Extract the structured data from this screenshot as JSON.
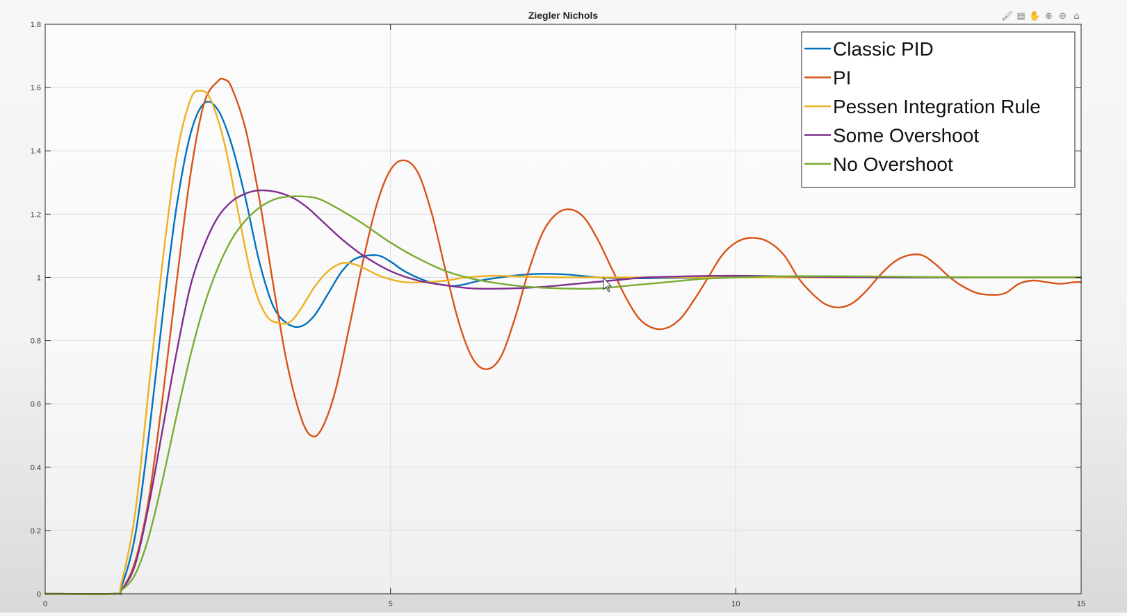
{
  "toolbar": {
    "icons": [
      "brush-icon",
      "datatip-icon",
      "pan-icon",
      "zoom-in-icon",
      "zoom-out-icon",
      "home-icon"
    ]
  },
  "chart_data": {
    "type": "line",
    "title": "Ziegler Nichols",
    "xlabel": "",
    "ylabel": "",
    "xlim": [
      0,
      15
    ],
    "ylim": [
      0,
      1.8
    ],
    "xticks": [
      "0",
      "5",
      "10",
      "15"
    ],
    "yticks": [
      "0",
      "0.2",
      "0.4",
      "0.6",
      "0.8",
      "1",
      "1.2",
      "1.4",
      "1.6",
      "1.8"
    ],
    "grid": true,
    "legend_position": "top-right",
    "series": [
      {
        "name": "Classic PID",
        "color": "#0072BD",
        "x": [
          0,
          1.0,
          1.1,
          1.3,
          1.5,
          1.7,
          1.9,
          2.1,
          2.3,
          2.5,
          2.7,
          2.9,
          3.1,
          3.3,
          3.5,
          3.7,
          3.9,
          4.1,
          4.3,
          4.5,
          4.8,
          5.0,
          5.2,
          5.5,
          5.8,
          6.0,
          6.3,
          6.6,
          7.0,
          7.5,
          8.0,
          8.5,
          9.0,
          10.0,
          11.0,
          12.0,
          13.0,
          14.0,
          15.0
        ],
        "y": [
          0,
          0,
          0.02,
          0.18,
          0.5,
          0.88,
          1.22,
          1.45,
          1.55,
          1.53,
          1.42,
          1.25,
          1.05,
          0.91,
          0.855,
          0.845,
          0.88,
          0.95,
          1.02,
          1.06,
          1.07,
          1.05,
          1.02,
          0.99,
          0.975,
          0.975,
          0.99,
          1.0,
          1.01,
          1.01,
          1.0,
          0.997,
          0.998,
          1.0,
          1.002,
          1.0,
          1.0,
          1.0,
          1.0
        ]
      },
      {
        "name": "PI",
        "color": "#D95319",
        "x": [
          0,
          1.0,
          1.1,
          1.3,
          1.5,
          1.7,
          1.9,
          2.1,
          2.3,
          2.5,
          2.6,
          2.7,
          2.9,
          3.1,
          3.3,
          3.5,
          3.7,
          3.85,
          4.0,
          4.2,
          4.4,
          4.6,
          4.8,
          5.0,
          5.2,
          5.4,
          5.6,
          5.8,
          6.0,
          6.2,
          6.4,
          6.6,
          6.8,
          7.0,
          7.2,
          7.4,
          7.6,
          7.8,
          8.0,
          8.2,
          8.4,
          8.6,
          8.8,
          9.0,
          9.2,
          9.4,
          9.6,
          9.8,
          10.0,
          10.2,
          10.45,
          10.7,
          10.9,
          11.1,
          11.3,
          11.5,
          11.7,
          11.9,
          12.1,
          12.3,
          12.5,
          12.7,
          12.9,
          13.1,
          13.3,
          13.5,
          13.7,
          13.9,
          14.1,
          14.3,
          14.5,
          14.7,
          14.9,
          15.0
        ],
        "y": [
          0,
          0,
          0.01,
          0.1,
          0.3,
          0.62,
          0.98,
          1.32,
          1.55,
          1.62,
          1.625,
          1.6,
          1.47,
          1.25,
          0.98,
          0.73,
          0.56,
          0.5,
          0.52,
          0.64,
          0.84,
          1.05,
          1.23,
          1.34,
          1.37,
          1.33,
          1.2,
          1.02,
          0.85,
          0.74,
          0.71,
          0.75,
          0.87,
          1.02,
          1.14,
          1.2,
          1.215,
          1.19,
          1.12,
          1.03,
          0.94,
          0.87,
          0.84,
          0.84,
          0.87,
          0.93,
          1.0,
          1.07,
          1.11,
          1.125,
          1.115,
          1.07,
          1.0,
          0.95,
          0.915,
          0.905,
          0.92,
          0.96,
          1.01,
          1.05,
          1.07,
          1.07,
          1.04,
          1.0,
          0.97,
          0.95,
          0.945,
          0.95,
          0.98,
          0.99,
          0.985,
          0.98,
          0.985,
          0.985
        ]
      },
      {
        "name": "Pessen Integration Rule",
        "color": "#EDB120",
        "x": [
          0,
          1.0,
          1.1,
          1.3,
          1.5,
          1.7,
          1.9,
          2.1,
          2.25,
          2.4,
          2.6,
          2.8,
          3.0,
          3.2,
          3.4,
          3.55,
          3.7,
          3.9,
          4.1,
          4.3,
          4.5,
          4.7,
          4.9,
          5.2,
          5.5,
          5.8,
          6.1,
          6.5,
          7.0,
          7.5,
          8.0,
          9.0,
          10.0,
          11.0,
          12.0,
          13.0,
          14.0,
          15.0
        ],
        "y": [
          0,
          0,
          0.03,
          0.25,
          0.65,
          1.05,
          1.38,
          1.56,
          1.59,
          1.56,
          1.42,
          1.2,
          0.99,
          0.88,
          0.855,
          0.86,
          0.9,
          0.97,
          1.02,
          1.045,
          1.04,
          1.02,
          1.0,
          0.985,
          0.985,
          0.99,
          1.0,
          1.005,
          1.002,
          1.0,
          1.0,
          1.0,
          1.0,
          1.0,
          1.0,
          1.0,
          1.0,
          1.0
        ]
      },
      {
        "name": "Some Overshoot",
        "color": "#7E2F8E",
        "x": [
          0,
          1.0,
          1.1,
          1.3,
          1.5,
          1.7,
          1.9,
          2.1,
          2.3,
          2.5,
          2.7,
          2.9,
          3.1,
          3.35,
          3.6,
          3.8,
          4.0,
          4.3,
          4.6,
          5.0,
          5.4,
          5.8,
          6.2,
          6.7,
          7.2,
          7.7,
          8.2,
          8.7,
          9.2,
          9.7,
          10.2,
          10.7,
          11.5,
          12.5,
          13.5,
          14.5,
          15.0
        ],
        "y": [
          0,
          0,
          0.01,
          0.09,
          0.28,
          0.52,
          0.76,
          0.97,
          1.1,
          1.19,
          1.24,
          1.265,
          1.275,
          1.27,
          1.25,
          1.22,
          1.18,
          1.12,
          1.07,
          1.02,
          0.99,
          0.975,
          0.965,
          0.965,
          0.97,
          0.98,
          0.99,
          1.0,
          1.003,
          1.005,
          1.005,
          1.003,
          1.001,
          1.0,
          1.0,
          1.0,
          1.0
        ]
      },
      {
        "name": "No Overshoot",
        "color": "#77AC30",
        "x": [
          0,
          1.0,
          1.1,
          1.3,
          1.5,
          1.7,
          1.9,
          2.1,
          2.3,
          2.5,
          2.7,
          2.9,
          3.1,
          3.3,
          3.5,
          3.8,
          4.0,
          4.3,
          4.6,
          5.0,
          5.4,
          5.8,
          6.2,
          6.6,
          7.0,
          7.5,
          8.0,
          8.5,
          9.0,
          9.5,
          10.0,
          10.5,
          11.0,
          12.0,
          13.0,
          14.0,
          15.0
        ],
        "y": [
          0,
          0,
          0.01,
          0.06,
          0.18,
          0.36,
          0.56,
          0.75,
          0.91,
          1.03,
          1.12,
          1.18,
          1.22,
          1.245,
          1.255,
          1.255,
          1.245,
          1.21,
          1.17,
          1.11,
          1.06,
          1.02,
          0.995,
          0.98,
          0.97,
          0.965,
          0.965,
          0.975,
          0.985,
          0.995,
          1.0,
          1.003,
          1.004,
          1.003,
          1.001,
          1.0,
          1.0
        ]
      }
    ]
  }
}
